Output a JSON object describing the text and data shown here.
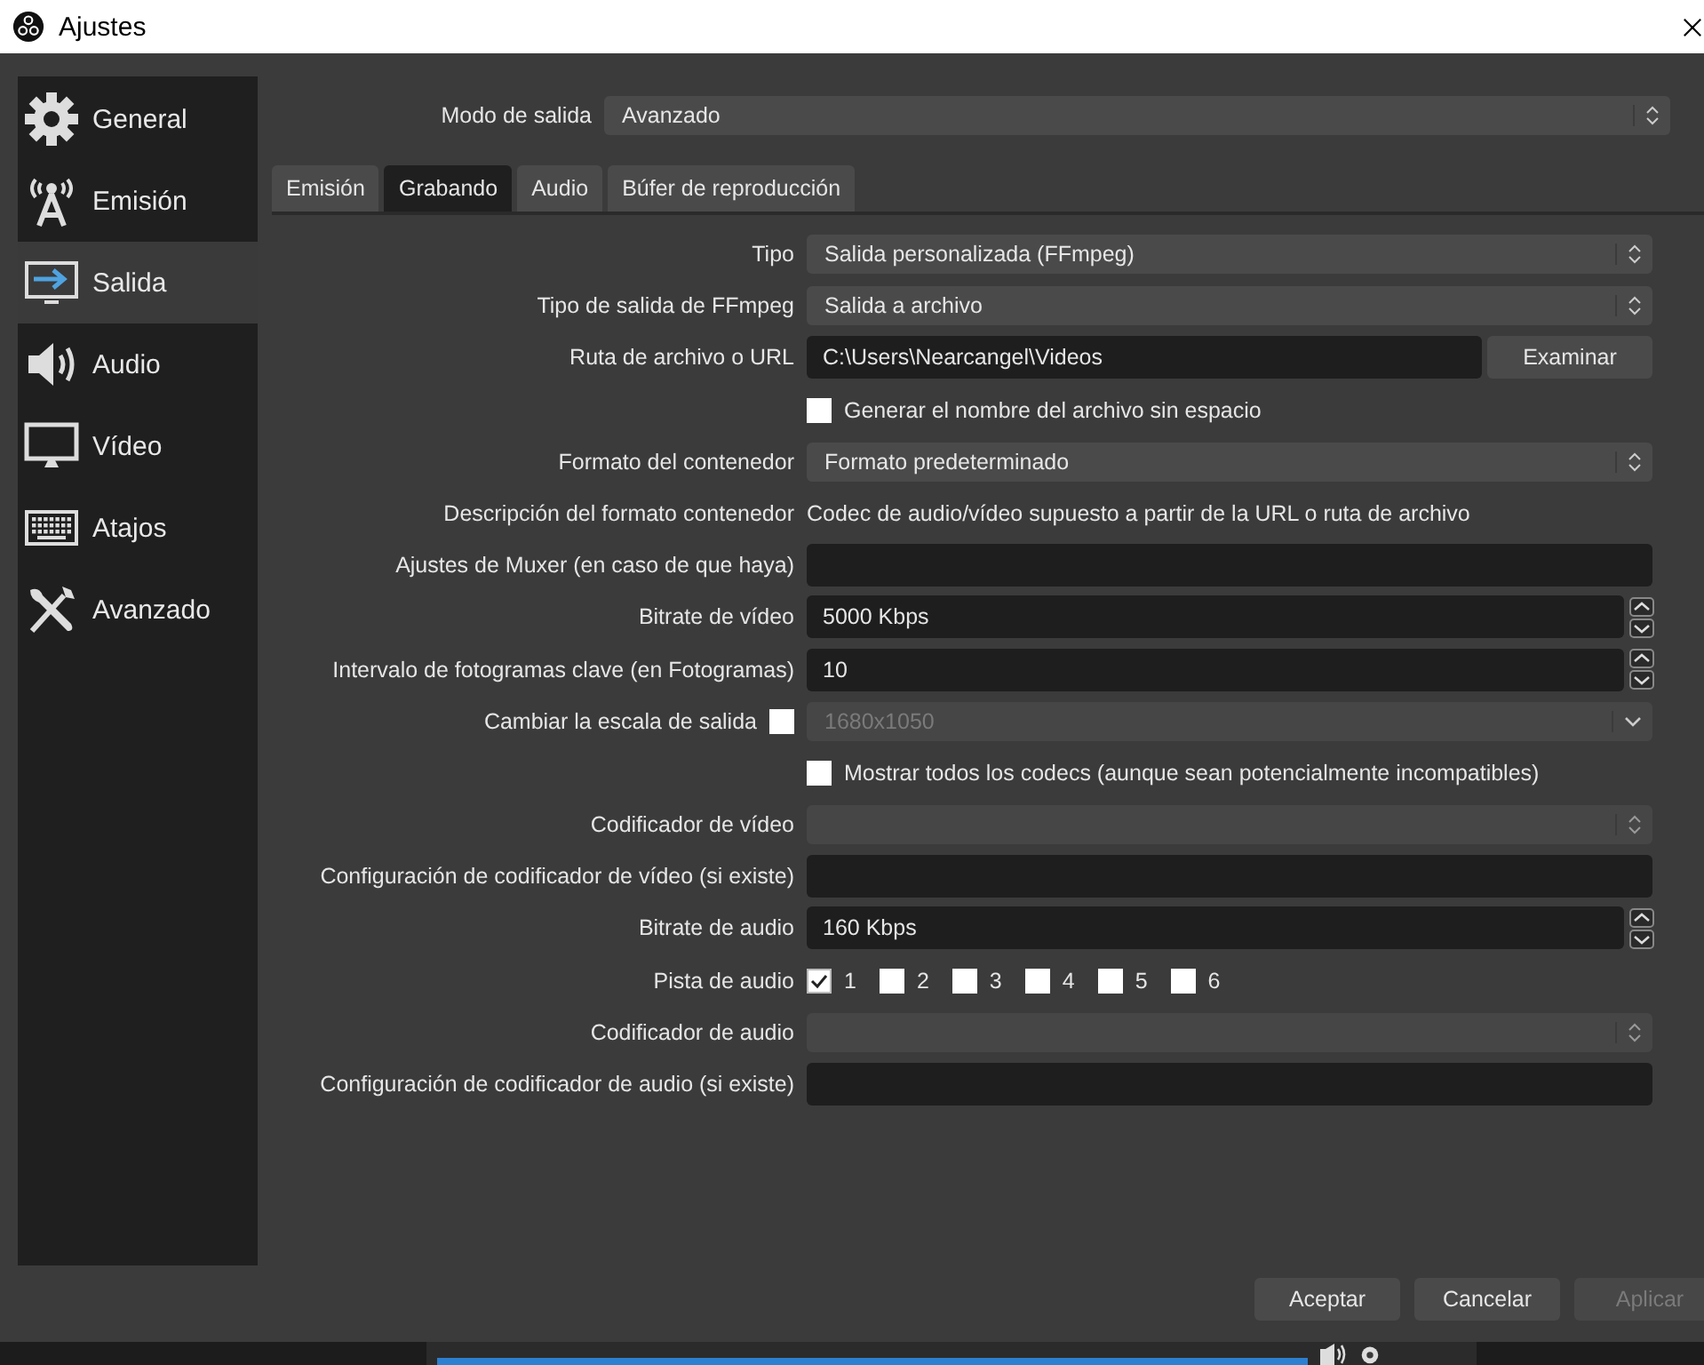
{
  "window": {
    "title": "Ajustes"
  },
  "sidebar": {
    "items": [
      {
        "label": "General",
        "selected": false
      },
      {
        "label": "Emisión",
        "selected": false
      },
      {
        "label": "Salida",
        "selected": true
      },
      {
        "label": "Audio",
        "selected": false
      },
      {
        "label": "Vídeo",
        "selected": false
      },
      {
        "label": "Atajos",
        "selected": false
      },
      {
        "label": "Avanzado",
        "selected": false
      }
    ]
  },
  "output_mode": {
    "label": "Modo de salida",
    "value": "Avanzado"
  },
  "tabs": [
    {
      "label": "Emisión",
      "selected": false
    },
    {
      "label": "Grabando",
      "selected": true
    },
    {
      "label": "Audio",
      "selected": false
    },
    {
      "label": "Búfer de reproducción",
      "selected": false
    }
  ],
  "form": [
    {
      "kind": "combo",
      "label": "Tipo",
      "value": "Salida personalizada (FFmpeg)",
      "disabled": false
    },
    {
      "kind": "combo",
      "label": "Tipo de salida de FFmpeg",
      "value": "Salida a archivo",
      "disabled": false
    },
    {
      "kind": "path",
      "label": "Ruta de archivo o URL",
      "value": "C:\\Users\\Nearcangel\\Videos",
      "button": "Examinar"
    },
    {
      "kind": "checkbox",
      "label": "Generar el nombre del archivo sin espacio",
      "checked": false
    },
    {
      "kind": "combo",
      "label": "Formato del contenedor",
      "value": "Formato predeterminado",
      "disabled": false
    },
    {
      "kind": "text",
      "label": "Descripción del formato contenedor",
      "value": "Codec de audio/vídeo supuesto a partir de la URL o ruta de archivo"
    },
    {
      "kind": "input",
      "label": "Ajustes de Muxer (en caso de que haya)"
    },
    {
      "kind": "spin",
      "label": "Bitrate de vídeo",
      "value": "5000 Kbps"
    },
    {
      "kind": "spin",
      "label": "Intervalo de fotogramas clave (en Fotogramas)",
      "value": "10"
    },
    {
      "kind": "scale",
      "label": "Cambiar la escala de salida",
      "checked": false,
      "value": "1680x1050",
      "disabled": true
    },
    {
      "kind": "checkbox",
      "label": "Mostrar todos los codecs (aunque sean potencialmente incompatibles)",
      "checked": false
    },
    {
      "kind": "combo",
      "label": "Codificador de vídeo",
      "disabled": true
    },
    {
      "kind": "input",
      "label": "Configuración de codificador de vídeo (si existe)"
    },
    {
      "kind": "spin",
      "label": "Bitrate de audio",
      "value": "160 Kbps"
    },
    {
      "kind": "tracks",
      "label": "Pista de audio",
      "tracks": [
        {
          "label": "1",
          "checked": true
        },
        {
          "label": "2",
          "checked": false
        },
        {
          "label": "3",
          "checked": false
        },
        {
          "label": "4",
          "checked": false
        },
        {
          "label": "5",
          "checked": false
        },
        {
          "label": "6",
          "checked": false
        }
      ]
    },
    {
      "kind": "combo",
      "label": "Codificador de audio",
      "disabled": true
    },
    {
      "kind": "input",
      "label": "Configuración de codificador de audio (si existe)"
    }
  ],
  "buttons": [
    {
      "label": "Aceptar",
      "disabled": false
    },
    {
      "label": "Cancelar",
      "disabled": false
    },
    {
      "label": "Aplicar",
      "disabled": true
    }
  ]
}
